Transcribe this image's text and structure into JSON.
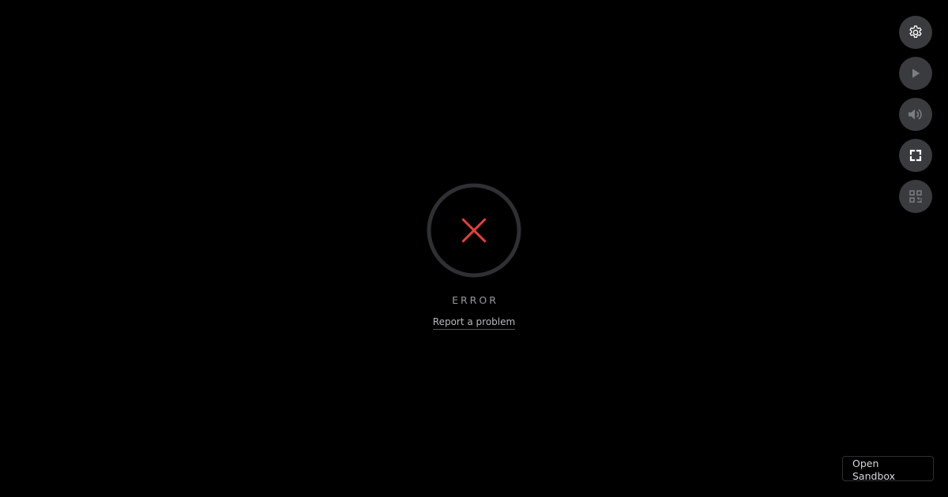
{
  "status": {
    "label": "ERROR",
    "link_text": "Report a problem"
  },
  "controls": [
    {
      "name": "settings",
      "icon": "gear-icon",
      "enabled": true
    },
    {
      "name": "play",
      "icon": "play-icon",
      "enabled": false
    },
    {
      "name": "volume",
      "icon": "volume-icon",
      "enabled": false
    },
    {
      "name": "fullscreen",
      "icon": "fullscreen-icon",
      "enabled": true
    },
    {
      "name": "qr",
      "icon": "qr-code-icon",
      "enabled": false
    }
  ],
  "footer": {
    "open_sandbox_label": "Open Sandbox"
  },
  "colors": {
    "background": "#000000",
    "ring": "#2f3034",
    "error_cross": "#e8403a",
    "button_bg": "#3a3b3f",
    "icon_enabled": "#ffffff",
    "icon_disabled": "#7c7d81"
  }
}
